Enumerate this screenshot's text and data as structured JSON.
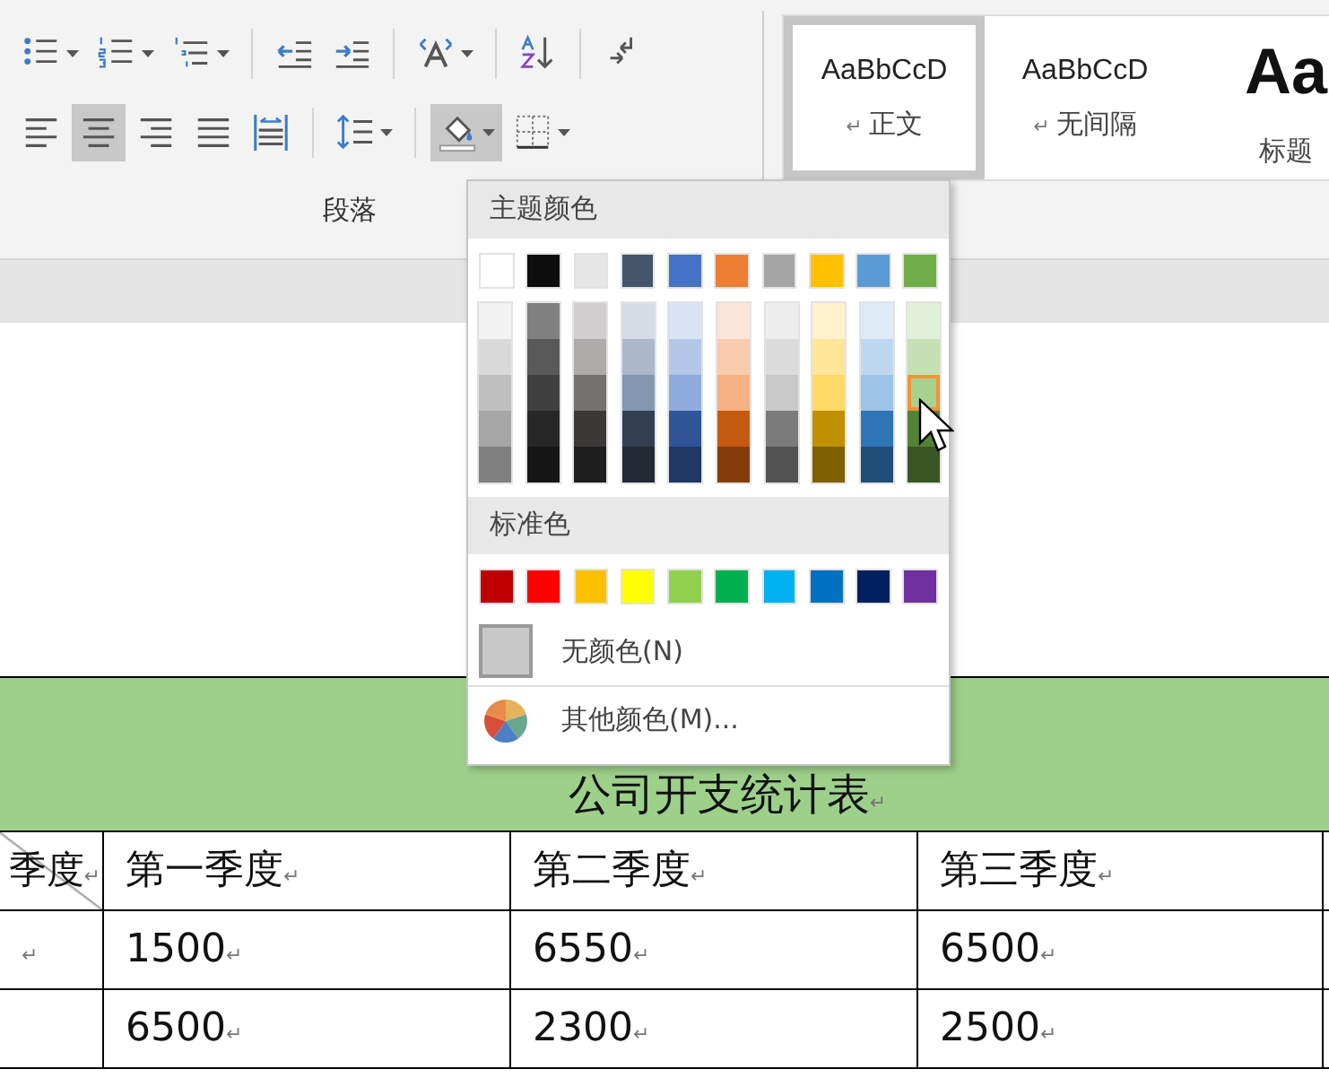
{
  "ribbon": {
    "paragraph_group": {
      "label": "段落",
      "rows": [
        {
          "buttons": [
            {
              "kind": "bullets",
              "dropdown": true,
              "selected": false
            },
            {
              "kind": "numbering",
              "dropdown": true,
              "selected": false
            },
            {
              "kind": "multilevel",
              "dropdown": true,
              "selected": false
            },
            {
              "kind": "separator"
            },
            {
              "kind": "indent_decrease",
              "dropdown": false,
              "selected": false
            },
            {
              "kind": "indent_increase",
              "dropdown": false,
              "selected": false
            },
            {
              "kind": "separator"
            },
            {
              "kind": "asian_layout",
              "dropdown": true,
              "selected": false
            },
            {
              "kind": "separator"
            },
            {
              "kind": "sort",
              "dropdown": false,
              "selected": false
            },
            {
              "kind": "separator"
            },
            {
              "kind": "show_marks",
              "dropdown": false,
              "selected": false
            }
          ]
        },
        {
          "buttons": [
            {
              "kind": "align_left",
              "dropdown": false,
              "selected": false
            },
            {
              "kind": "align_center",
              "dropdown": false,
              "selected": true
            },
            {
              "kind": "align_right",
              "dropdown": false,
              "selected": false
            },
            {
              "kind": "justify",
              "dropdown": false,
              "selected": false
            },
            {
              "kind": "distributed",
              "dropdown": false,
              "selected": false
            },
            {
              "kind": "separator"
            },
            {
              "kind": "line_spacing",
              "dropdown": true,
              "selected": false
            },
            {
              "kind": "separator"
            },
            {
              "kind": "shading",
              "dropdown": true,
              "selected": true
            },
            {
              "kind": "borders",
              "dropdown": true,
              "selected": false
            }
          ]
        }
      ]
    },
    "styles": [
      {
        "kind": "normal",
        "preview": "AaBbCcD",
        "label": "正文",
        "mark": "↵",
        "selected": true
      },
      {
        "kind": "normal",
        "preview": "AaBbCcD",
        "label": "无间隔",
        "mark": "↵",
        "selected": false
      },
      {
        "kind": "heading",
        "preview": "Aa",
        "label": "标题",
        "selected": false
      }
    ]
  },
  "color_menu": {
    "theme_heading": "主题颜色",
    "theme_colors": [
      {
        "color": "#ffffff",
        "selected": false,
        "shades": [
          {
            "color": "#f2f2f2",
            "selected": false
          },
          {
            "color": "#d9d9d9",
            "selected": false
          },
          {
            "color": "#bfbfbf",
            "selected": false
          },
          {
            "color": "#a6a6a6",
            "selected": false
          },
          {
            "color": "#808080",
            "selected": false
          }
        ]
      },
      {
        "color": "#0d0d0d",
        "selected": false,
        "shades": [
          {
            "color": "#808080",
            "selected": false
          },
          {
            "color": "#595959",
            "selected": false
          },
          {
            "color": "#404040",
            "selected": false
          },
          {
            "color": "#262626",
            "selected": false
          },
          {
            "color": "#161616",
            "selected": false
          }
        ]
      },
      {
        "color": "#e7e6e6",
        "selected": false,
        "shades": [
          {
            "color": "#d0cece",
            "selected": false
          },
          {
            "color": "#aeabab",
            "selected": false
          },
          {
            "color": "#767171",
            "selected": false
          },
          {
            "color": "#3b3838",
            "selected": false
          },
          {
            "color": "#1e1e1e",
            "selected": false
          }
        ]
      },
      {
        "color": "#44546a",
        "selected": false,
        "shades": [
          {
            "color": "#d6dce5",
            "selected": false
          },
          {
            "color": "#adb9ca",
            "selected": false
          },
          {
            "color": "#8497b0",
            "selected": false
          },
          {
            "color": "#333f50",
            "selected": false
          },
          {
            "color": "#222a35",
            "selected": false
          }
        ]
      },
      {
        "color": "#4472c4",
        "selected": false,
        "shades": [
          {
            "color": "#dae3f3",
            "selected": false
          },
          {
            "color": "#b4c7e7",
            "selected": false
          },
          {
            "color": "#8faadc",
            "selected": false
          },
          {
            "color": "#2f5597",
            "selected": false
          },
          {
            "color": "#203864",
            "selected": false
          }
        ]
      },
      {
        "color": "#ed7d31",
        "selected": false,
        "shades": [
          {
            "color": "#fbe5d6",
            "selected": false
          },
          {
            "color": "#f8cbad",
            "selected": false
          },
          {
            "color": "#f4b183",
            "selected": false
          },
          {
            "color": "#c55a11",
            "selected": false
          },
          {
            "color": "#843c0c",
            "selected": false
          }
        ]
      },
      {
        "color": "#a5a5a5",
        "selected": false,
        "shades": [
          {
            "color": "#ededed",
            "selected": false
          },
          {
            "color": "#dbdbdb",
            "selected": false
          },
          {
            "color": "#c9c9c9",
            "selected": false
          },
          {
            "color": "#7b7b7b",
            "selected": false
          },
          {
            "color": "#525252",
            "selected": false
          }
        ]
      },
      {
        "color": "#ffc000",
        "selected": false,
        "shades": [
          {
            "color": "#fff2cc",
            "selected": false
          },
          {
            "color": "#ffe699",
            "selected": false
          },
          {
            "color": "#ffd966",
            "selected": false
          },
          {
            "color": "#bf9000",
            "selected": false
          },
          {
            "color": "#7f6000",
            "selected": false
          }
        ]
      },
      {
        "color": "#5b9bd5",
        "selected": false,
        "shades": [
          {
            "color": "#deebf7",
            "selected": false
          },
          {
            "color": "#bdd7ee",
            "selected": false
          },
          {
            "color": "#9dc3e6",
            "selected": false
          },
          {
            "color": "#2e75b6",
            "selected": false
          },
          {
            "color": "#1f4e79",
            "selected": false
          }
        ]
      },
      {
        "color": "#70ad47",
        "selected": false,
        "shades": [
          {
            "color": "#e2f0d9",
            "selected": false
          },
          {
            "color": "#c5e0b4",
            "selected": false
          },
          {
            "color": "#a9d18e",
            "selected": true
          },
          {
            "color": "#548235",
            "selected": false
          },
          {
            "color": "#385723",
            "selected": false
          }
        ]
      }
    ],
    "standard_heading": "标准色",
    "standard_colors": [
      {
        "color": "#c00000",
        "selected": false
      },
      {
        "color": "#ff0000",
        "selected": false
      },
      {
        "color": "#ffc000",
        "selected": false
      },
      {
        "color": "#ffff00",
        "selected": false
      },
      {
        "color": "#92d050",
        "selected": false
      },
      {
        "color": "#00b050",
        "selected": false
      },
      {
        "color": "#00b0f0",
        "selected": false
      },
      {
        "color": "#0070c0",
        "selected": false
      },
      {
        "color": "#002060",
        "selected": false
      },
      {
        "color": "#7030a0",
        "selected": false
      }
    ],
    "items": [
      {
        "kind": "no_color",
        "label": "无颜色(N)"
      },
      {
        "kind": "more_colors",
        "label": "其他颜色(M)..."
      }
    ]
  },
  "document": {
    "table": {
      "title": "公司开支统计表",
      "title_mark": "↵",
      "header": [
        {
          "kind": "diagonal",
          "text": "季度",
          "mark": "↵"
        },
        {
          "text": "第一季度",
          "mark": "↵"
        },
        {
          "text": "第二季度",
          "mark": "↵"
        },
        {
          "text": "第三季度",
          "mark": "↵"
        }
      ],
      "rows": [
        [
          {
            "mark": "↵"
          },
          {
            "text": "1500",
            "mark": "↵"
          },
          {
            "text": "6550",
            "mark": "↵"
          },
          {
            "text": "6500",
            "mark": "↵"
          }
        ],
        [
          {},
          {
            "text": "6500",
            "mark": "↵"
          },
          {
            "text": "2300",
            "mark": "↵"
          },
          {
            "text": "2500",
            "mark": "↵"
          }
        ]
      ]
    }
  }
}
